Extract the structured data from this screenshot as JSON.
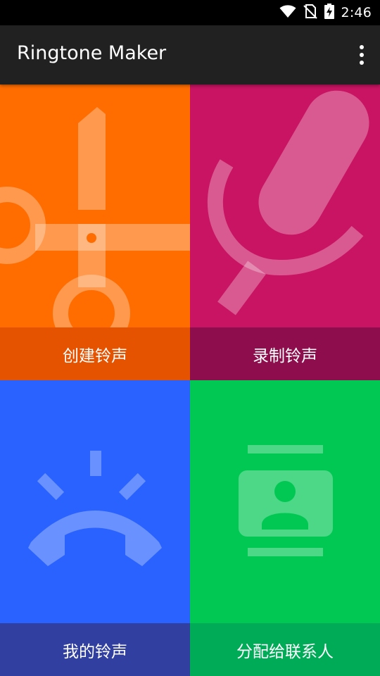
{
  "status_bar": {
    "time": "2:46",
    "icons": [
      "wifi-icon",
      "no-sim-icon",
      "battery-charging-icon"
    ]
  },
  "app_bar": {
    "title": "Ringtone Maker",
    "menu_icon": "more-vert-icon"
  },
  "tiles": [
    {
      "label": "创建铃声",
      "icon": "scissors-icon",
      "color": "#ff6d00",
      "label_bg": "#e55200"
    },
    {
      "label": "录制铃声",
      "icon": "microphone-icon",
      "color": "#c81462",
      "label_bg": "#8e0e4d"
    },
    {
      "label": "我的铃声",
      "icon": "phone-ringing-icon",
      "color": "#2962ff",
      "label_bg": "#303fa0"
    },
    {
      "label": "分配给联系人",
      "icon": "contact-card-icon",
      "color": "#00c853",
      "label_bg": "#00ab58"
    }
  ]
}
